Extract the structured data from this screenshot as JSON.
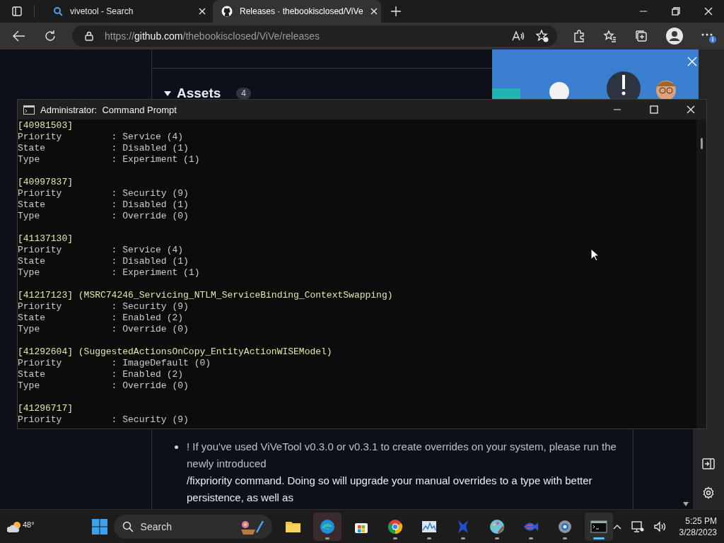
{
  "browser": {
    "tabs": [
      {
        "title": "vivetool - Search",
        "kind": "search",
        "selected": false
      },
      {
        "title": "Releases · thebookisclosed/ViVe",
        "kind": "github",
        "selected": true
      }
    ],
    "address": {
      "scheme": "https://",
      "host": "github.com",
      "path": "/thebookisclosed/ViVe/releases"
    }
  },
  "page": {
    "assets": {
      "title": "Assets",
      "count": "4",
      "expanded": true
    },
    "bullet_lines": [
      "! If you've used ViVeTool v0.3.0 or v0.3.1 to create overrides on your system, please run the newly introduced",
      "/fixpriority command. Doing so will upgrade your manual overrides to a type with better persistence, as well as"
    ]
  },
  "console": {
    "title": "Administrator:  Command Prompt",
    "entries": [
      {
        "id": "[40981503]",
        "lines": [
          "Priority         : Service (4)",
          "State            : Disabled (1)",
          "Type             : Experiment (1)"
        ]
      },
      {
        "id": "[40997837]",
        "lines": [
          "Priority         : Security (9)",
          "State            : Disabled (1)",
          "Type             : Override (0)"
        ]
      },
      {
        "id": "[41137130]",
        "lines": [
          "Priority         : Service (4)",
          "State            : Disabled (1)",
          "Type             : Experiment (1)"
        ]
      },
      {
        "id": "[41217123]",
        "name": "(MSRC74246_Servicing_NTLM_ServiceBinding_ContextSwapping)",
        "lines": [
          "Priority         : Security (9)",
          "State            : Enabled (2)",
          "Type             : Override (0)"
        ]
      },
      {
        "id": "[41292604]",
        "name": "(SuggestedActionsOnCopy_EntityActionWISEModel)",
        "lines": [
          "Priority         : ImageDefault (0)",
          "State            : Enabled (2)",
          "Type             : Override (0)"
        ]
      },
      {
        "id": "[41296717]",
        "lines": [
          "Priority         : Security (9)"
        ]
      }
    ]
  },
  "taskbar": {
    "weather": "48°",
    "search_label": "Search",
    "apps": [
      {
        "kind": "folder",
        "running": false,
        "selected": false,
        "hovered": false
      },
      {
        "kind": "edge",
        "running": true,
        "selected": false,
        "hovered": true
      },
      {
        "kind": "store",
        "running": false,
        "selected": false,
        "hovered": false
      },
      {
        "kind": "chrome",
        "running": true,
        "selected": false,
        "hovered": false
      },
      {
        "kind": "monitor",
        "running": true,
        "selected": false,
        "hovered": false
      },
      {
        "kind": "blue",
        "running": true,
        "selected": false,
        "hovered": false
      },
      {
        "kind": "paint",
        "running": true,
        "selected": false,
        "hovered": false
      },
      {
        "kind": "fish",
        "running": true,
        "selected": false,
        "hovered": false
      },
      {
        "kind": "gear",
        "running": true,
        "selected": false,
        "hovered": false
      },
      {
        "kind": "terminal",
        "running": true,
        "selected": true,
        "hovered": false
      }
    ],
    "time": "5:25 PM",
    "date": "3/28/2023"
  }
}
